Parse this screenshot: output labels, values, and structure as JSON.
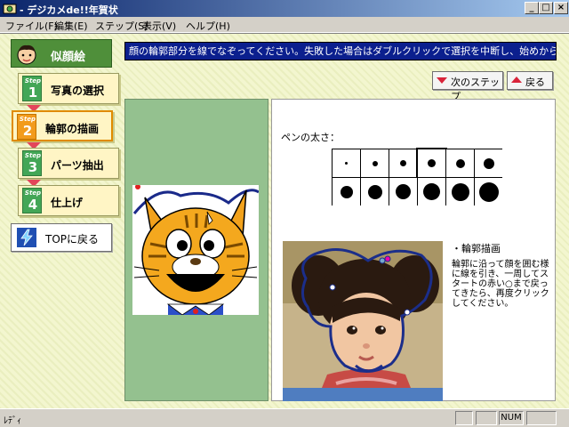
{
  "window": {
    "title": "- デジカメde!!年賀状",
    "minimize": "_",
    "maximize": "□",
    "close": "×"
  },
  "menu": [
    "ファイル(F)",
    "編集(E)",
    "ステップ(S)",
    "表示(V)",
    "ヘルプ(H)"
  ],
  "mode": {
    "label": "似顔絵",
    "icon": "boy-face-icon"
  },
  "steps": [
    {
      "badge": "Step",
      "num": "1",
      "label": "写真の選択",
      "active": false
    },
    {
      "badge": "Step",
      "num": "2",
      "label": "輪郭の描画",
      "active": true
    },
    {
      "badge": "Step",
      "num": "3",
      "label": "パーツ抽出",
      "active": false
    },
    {
      "badge": "Step",
      "num": "4",
      "label": "仕上げ",
      "active": false
    }
  ],
  "top_button": {
    "label": "TOPに戻る",
    "icon": "lightning-icon"
  },
  "instruction": "顔の輪郭部分を線でなぞってください。失敗した場合はダブルクリックで選択を中断し、始めからやりなおし",
  "nav": {
    "next": {
      "label": "次のステップ",
      "icon": "arrow-down-icon",
      "color": "#d9243a"
    },
    "back": {
      "label": "戻る",
      "icon": "arrow-up-icon",
      "color": "#d9243a"
    }
  },
  "pen": {
    "label": "ペンの太さ：",
    "selected_index": 3,
    "sizes": [
      "1",
      "2",
      "3",
      "4",
      "5",
      "6",
      "7",
      "8",
      "9",
      "10",
      "11",
      "12"
    ]
  },
  "description": {
    "title": "・輪郭描画",
    "body": "輪郭に沿って顔を囲む様に線を引き、一周してスタートの赤い○まで戻ってきたら、再度クリックしてください。"
  },
  "status": {
    "text": "ﾚﾃﾞｨ",
    "num": "NUM"
  },
  "colors": {
    "accent_green": "#4f8f3a",
    "instruction_bg": "#0b1f8e",
    "active_step": "#f29b1c",
    "step_badge": "#43a656"
  }
}
